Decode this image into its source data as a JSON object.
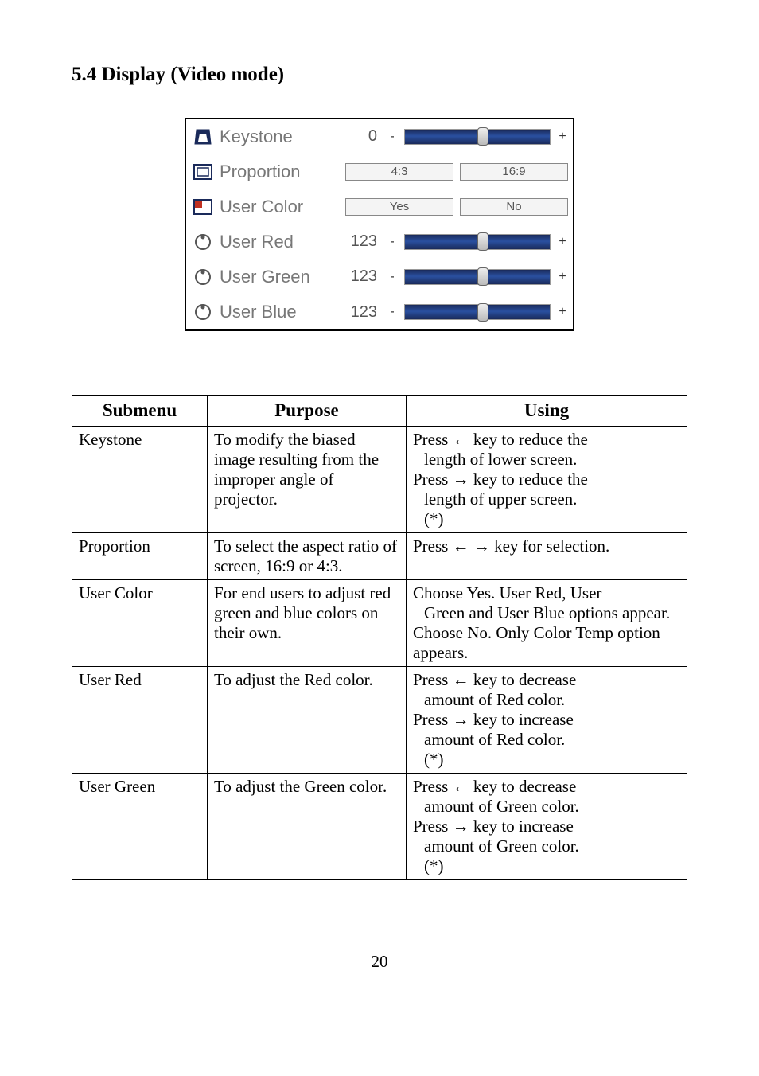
{
  "section_title": "5.4 Display (Video mode)",
  "osd": {
    "keystone": {
      "label": "Keystone",
      "value": "0"
    },
    "proportion": {
      "label": "Proportion",
      "opt1": "4:3",
      "opt2": "16:9"
    },
    "usercolor": {
      "label": "User Color",
      "opt1": "Yes",
      "opt2": "No"
    },
    "userred": {
      "label": "User Red",
      "value": "123"
    },
    "usergreen": {
      "label": "User Green",
      "value": "123"
    },
    "userblue": {
      "label": "User Blue",
      "value": "123"
    },
    "minus": "-",
    "plus": "+"
  },
  "table": {
    "headers": {
      "c1": "Submenu",
      "c2": "Purpose",
      "c3": "Using"
    },
    "rows": {
      "keystone": {
        "c1": "Keystone",
        "c2": "To modify the biased image resulting from the improper angle of projector.",
        "c3a": "Press ← key to reduce the",
        "c3b": "length of lower screen.",
        "c3c": "Press → key to reduce the",
        "c3d": "length of upper screen.",
        "c3e": "(*)"
      },
      "proportion": {
        "c1": "Proportion",
        "c2": "To select the aspect ratio of screen, 16:9 or 4:3.",
        "c3": "Press ← → key for selection."
      },
      "usercolor": {
        "c1": "User Color",
        "c2": "For end users to adjust red green and blue colors on their own.",
        "c3a": "Choose Yes. User Red, User",
        "c3b": "Green and User Blue options appear.",
        "c3c": "Choose No. Only Color Temp option appears."
      },
      "userred": {
        "c1": "User Red",
        "c2": "To adjust the Red color.",
        "c3a": "Press ← key to decrease",
        "c3b": "amount of Red color.",
        "c3c": "Press → key to increase",
        "c3d": "amount of Red color.",
        "c3e": "(*)"
      },
      "usergreen": {
        "c1": "User Green",
        "c2": "To adjust the Green color.",
        "c3a": "Press ← key to decrease",
        "c3b": "amount of Green color.",
        "c3c": "Press → key to increase",
        "c3d": "amount of Green color.",
        "c3e": "(*)"
      }
    }
  },
  "page_number": "20"
}
